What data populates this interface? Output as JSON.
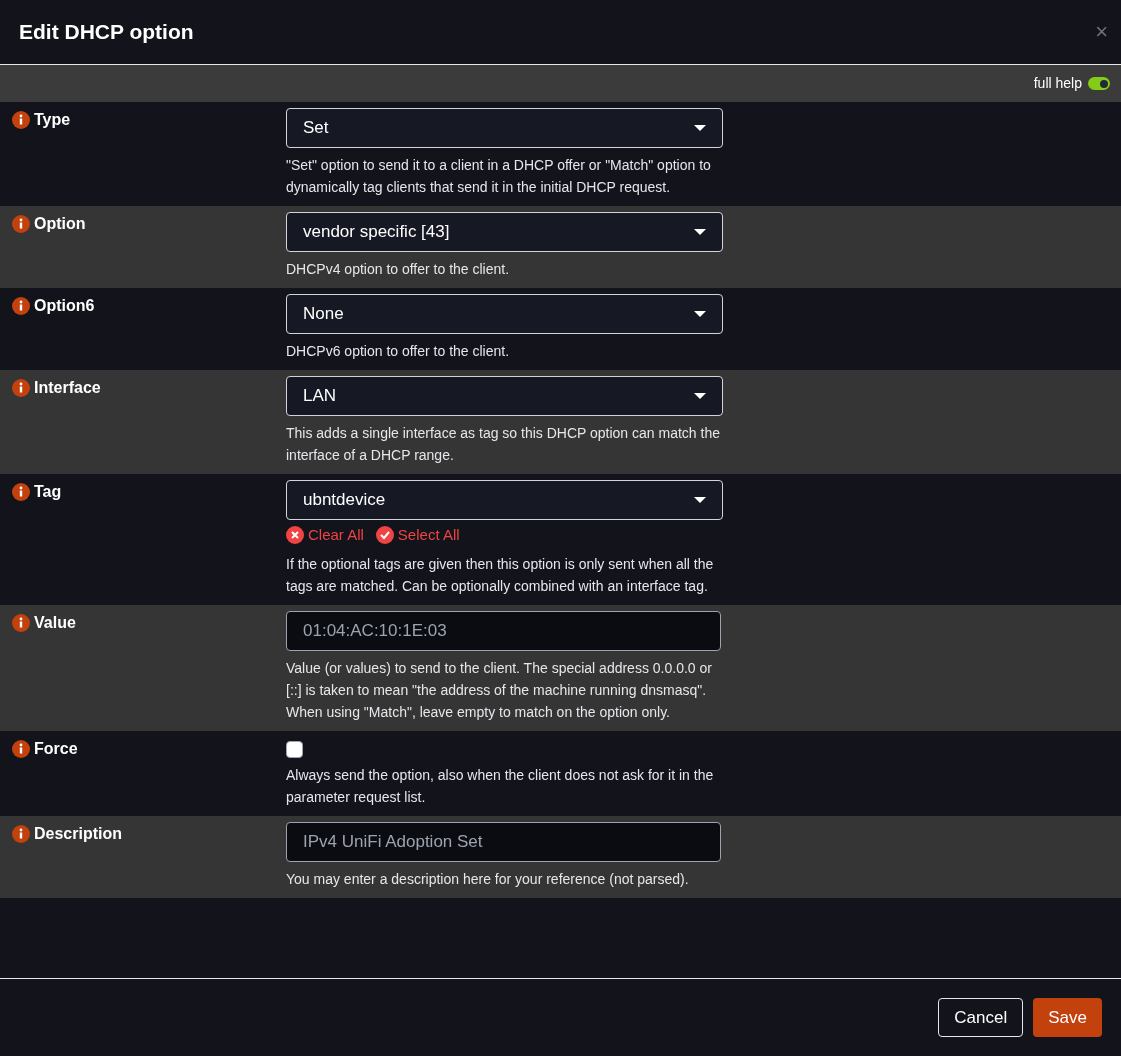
{
  "dialog": {
    "title": "Edit DHCP option",
    "close": "×"
  },
  "help_toggle": {
    "label": "full help",
    "on": true
  },
  "fields": [
    {
      "kind": "select",
      "label": "Type",
      "value": "Set",
      "help": "\"Set\" option to send it to a client in a DHCP offer or \"Match\" option to dynamically tag clients that send it in the initial DHCP request."
    },
    {
      "kind": "select",
      "label": "Option",
      "value": "vendor specific [43]",
      "help": "DHCPv4 option to offer to the client."
    },
    {
      "kind": "select",
      "label": "Option6",
      "value": "None",
      "help": "DHCPv6 option to offer to the client."
    },
    {
      "kind": "select",
      "label": "Interface",
      "value": "LAN",
      "help": "This adds a single interface as tag so this DHCP option can match the interface of a DHCP range."
    },
    {
      "kind": "select",
      "label": "Tag",
      "value": "ubntdevice",
      "actions": [
        "Clear All",
        "Select All"
      ],
      "help": "If the optional tags are given then this option is only sent when all the tags are matched. Can be optionally combined with an interface tag."
    },
    {
      "kind": "text",
      "label": "Value",
      "value": "01:04:AC:10:1E:03",
      "help": "Value (or values) to send to the client. The special address 0.0.0.0 or [::] is taken to mean \"the address of the machine running dnsmasq\". When using \"Match\", leave empty to match on the option only."
    },
    {
      "kind": "checkbox",
      "label": "Force",
      "checked": false,
      "help": "Always send the option, also when the client does not ask for it in the parameter request list."
    },
    {
      "kind": "text",
      "label": "Description",
      "value": "IPv4 UniFi Adoption Set",
      "help": "You may enter a description here for your reference (not parsed)."
    }
  ],
  "buttons": [
    "Cancel",
    "Save"
  ]
}
